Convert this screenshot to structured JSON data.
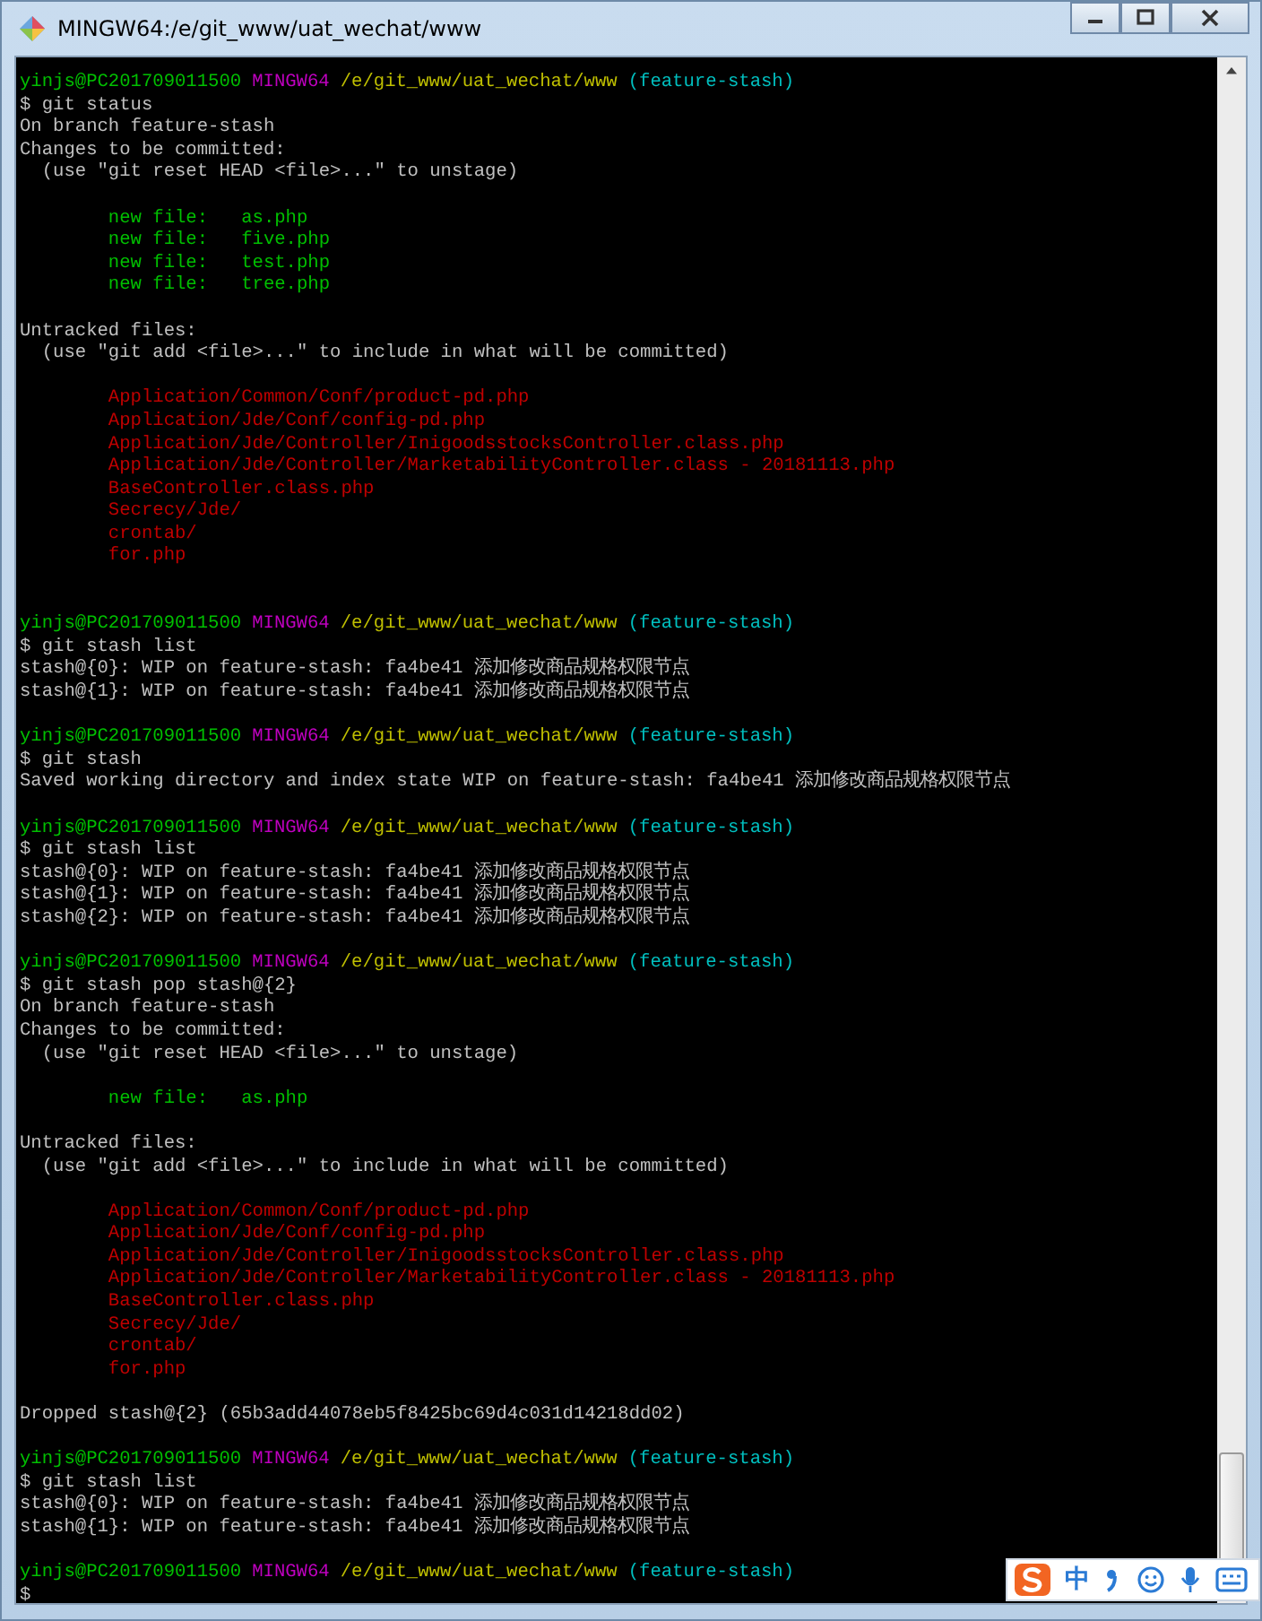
{
  "window": {
    "title": "MINGW64:/e/git_www/uat_wechat/www"
  },
  "lines": [
    {
      "kind": "prompt",
      "user": "yinjs@PC201709011500",
      "shell": "MINGW64",
      "path": "/e/git_www/uat_wechat/www",
      "branch": "(feature-stash)"
    },
    {
      "kind": "plain",
      "text": "$ git status"
    },
    {
      "kind": "plain",
      "text": "On branch feature-stash"
    },
    {
      "kind": "plain",
      "text": "Changes to be committed:"
    },
    {
      "kind": "plain",
      "text": "  (use \"git reset HEAD <file>...\" to unstage)"
    },
    {
      "kind": "blank"
    },
    {
      "kind": "added",
      "text": "        new file:   as.php"
    },
    {
      "kind": "added",
      "text": "        new file:   five.php"
    },
    {
      "kind": "added",
      "text": "        new file:   test.php"
    },
    {
      "kind": "added",
      "text": "        new file:   tree.php"
    },
    {
      "kind": "blank"
    },
    {
      "kind": "plain",
      "text": "Untracked files:"
    },
    {
      "kind": "plain",
      "text": "  (use \"git add <file>...\" to include in what will be committed)"
    },
    {
      "kind": "blank"
    },
    {
      "kind": "untracked",
      "text": "        Application/Common/Conf/product-pd.php"
    },
    {
      "kind": "untracked",
      "text": "        Application/Jde/Conf/config-pd.php"
    },
    {
      "kind": "untracked",
      "text": "        Application/Jde/Controller/InigoodsstocksController.class.php"
    },
    {
      "kind": "untracked",
      "text": "        Application/Jde/Controller/MarketabilityController.class - 20181113.php"
    },
    {
      "kind": "untracked",
      "text": "        BaseController.class.php"
    },
    {
      "kind": "untracked",
      "text": "        Secrecy/Jde/"
    },
    {
      "kind": "untracked",
      "text": "        crontab/"
    },
    {
      "kind": "untracked",
      "text": "        for.php"
    },
    {
      "kind": "blank"
    },
    {
      "kind": "blank"
    },
    {
      "kind": "prompt",
      "user": "yinjs@PC201709011500",
      "shell": "MINGW64",
      "path": "/e/git_www/uat_wechat/www",
      "branch": "(feature-stash)"
    },
    {
      "kind": "plain",
      "text": "$ git stash list"
    },
    {
      "kind": "plain",
      "text": "stash@{0}: WIP on feature-stash: fa4be41 添加修改商品规格权限节点"
    },
    {
      "kind": "plain",
      "text": "stash@{1}: WIP on feature-stash: fa4be41 添加修改商品规格权限节点"
    },
    {
      "kind": "blank"
    },
    {
      "kind": "prompt",
      "user": "yinjs@PC201709011500",
      "shell": "MINGW64",
      "path": "/e/git_www/uat_wechat/www",
      "branch": "(feature-stash)"
    },
    {
      "kind": "plain",
      "text": "$ git stash"
    },
    {
      "kind": "plain",
      "text": "Saved working directory and index state WIP on feature-stash: fa4be41 添加修改商品规格权限节点"
    },
    {
      "kind": "blank"
    },
    {
      "kind": "prompt",
      "user": "yinjs@PC201709011500",
      "shell": "MINGW64",
      "path": "/e/git_www/uat_wechat/www",
      "branch": "(feature-stash)"
    },
    {
      "kind": "plain",
      "text": "$ git stash list"
    },
    {
      "kind": "plain",
      "text": "stash@{0}: WIP on feature-stash: fa4be41 添加修改商品规格权限节点"
    },
    {
      "kind": "plain",
      "text": "stash@{1}: WIP on feature-stash: fa4be41 添加修改商品规格权限节点"
    },
    {
      "kind": "plain",
      "text": "stash@{2}: WIP on feature-stash: fa4be41 添加修改商品规格权限节点"
    },
    {
      "kind": "blank"
    },
    {
      "kind": "prompt",
      "user": "yinjs@PC201709011500",
      "shell": "MINGW64",
      "path": "/e/git_www/uat_wechat/www",
      "branch": "(feature-stash)"
    },
    {
      "kind": "plain",
      "text": "$ git stash pop stash@{2}"
    },
    {
      "kind": "plain",
      "text": "On branch feature-stash"
    },
    {
      "kind": "plain",
      "text": "Changes to be committed:"
    },
    {
      "kind": "plain",
      "text": "  (use \"git reset HEAD <file>...\" to unstage)"
    },
    {
      "kind": "blank"
    },
    {
      "kind": "added",
      "text": "        new file:   as.php"
    },
    {
      "kind": "blank"
    },
    {
      "kind": "plain",
      "text": "Untracked files:"
    },
    {
      "kind": "plain",
      "text": "  (use \"git add <file>...\" to include in what will be committed)"
    },
    {
      "kind": "blank"
    },
    {
      "kind": "untracked",
      "text": "        Application/Common/Conf/product-pd.php"
    },
    {
      "kind": "untracked",
      "text": "        Application/Jde/Conf/config-pd.php"
    },
    {
      "kind": "untracked",
      "text": "        Application/Jde/Controller/InigoodsstocksController.class.php"
    },
    {
      "kind": "untracked",
      "text": "        Application/Jde/Controller/MarketabilityController.class - 20181113.php"
    },
    {
      "kind": "untracked",
      "text": "        BaseController.class.php"
    },
    {
      "kind": "untracked",
      "text": "        Secrecy/Jde/"
    },
    {
      "kind": "untracked",
      "text": "        crontab/"
    },
    {
      "kind": "untracked",
      "text": "        for.php"
    },
    {
      "kind": "blank"
    },
    {
      "kind": "plain",
      "text": "Dropped stash@{2} (65b3add44078eb5f8425bc69d4c031d14218dd02)"
    },
    {
      "kind": "blank"
    },
    {
      "kind": "prompt",
      "user": "yinjs@PC201709011500",
      "shell": "MINGW64",
      "path": "/e/git_www/uat_wechat/www",
      "branch": "(feature-stash)"
    },
    {
      "kind": "plain",
      "text": "$ git stash list"
    },
    {
      "kind": "plain",
      "text": "stash@{0}: WIP on feature-stash: fa4be41 添加修改商品规格权限节点"
    },
    {
      "kind": "plain",
      "text": "stash@{1}: WIP on feature-stash: fa4be41 添加修改商品规格权限节点"
    },
    {
      "kind": "blank"
    },
    {
      "kind": "prompt",
      "user": "yinjs@PC201709011500",
      "shell": "MINGW64",
      "path": "/e/git_www/uat_wechat/www",
      "branch": "(feature-stash)"
    },
    {
      "kind": "plain",
      "text": "$"
    }
  ],
  "ime": {
    "mode_label": "中"
  }
}
